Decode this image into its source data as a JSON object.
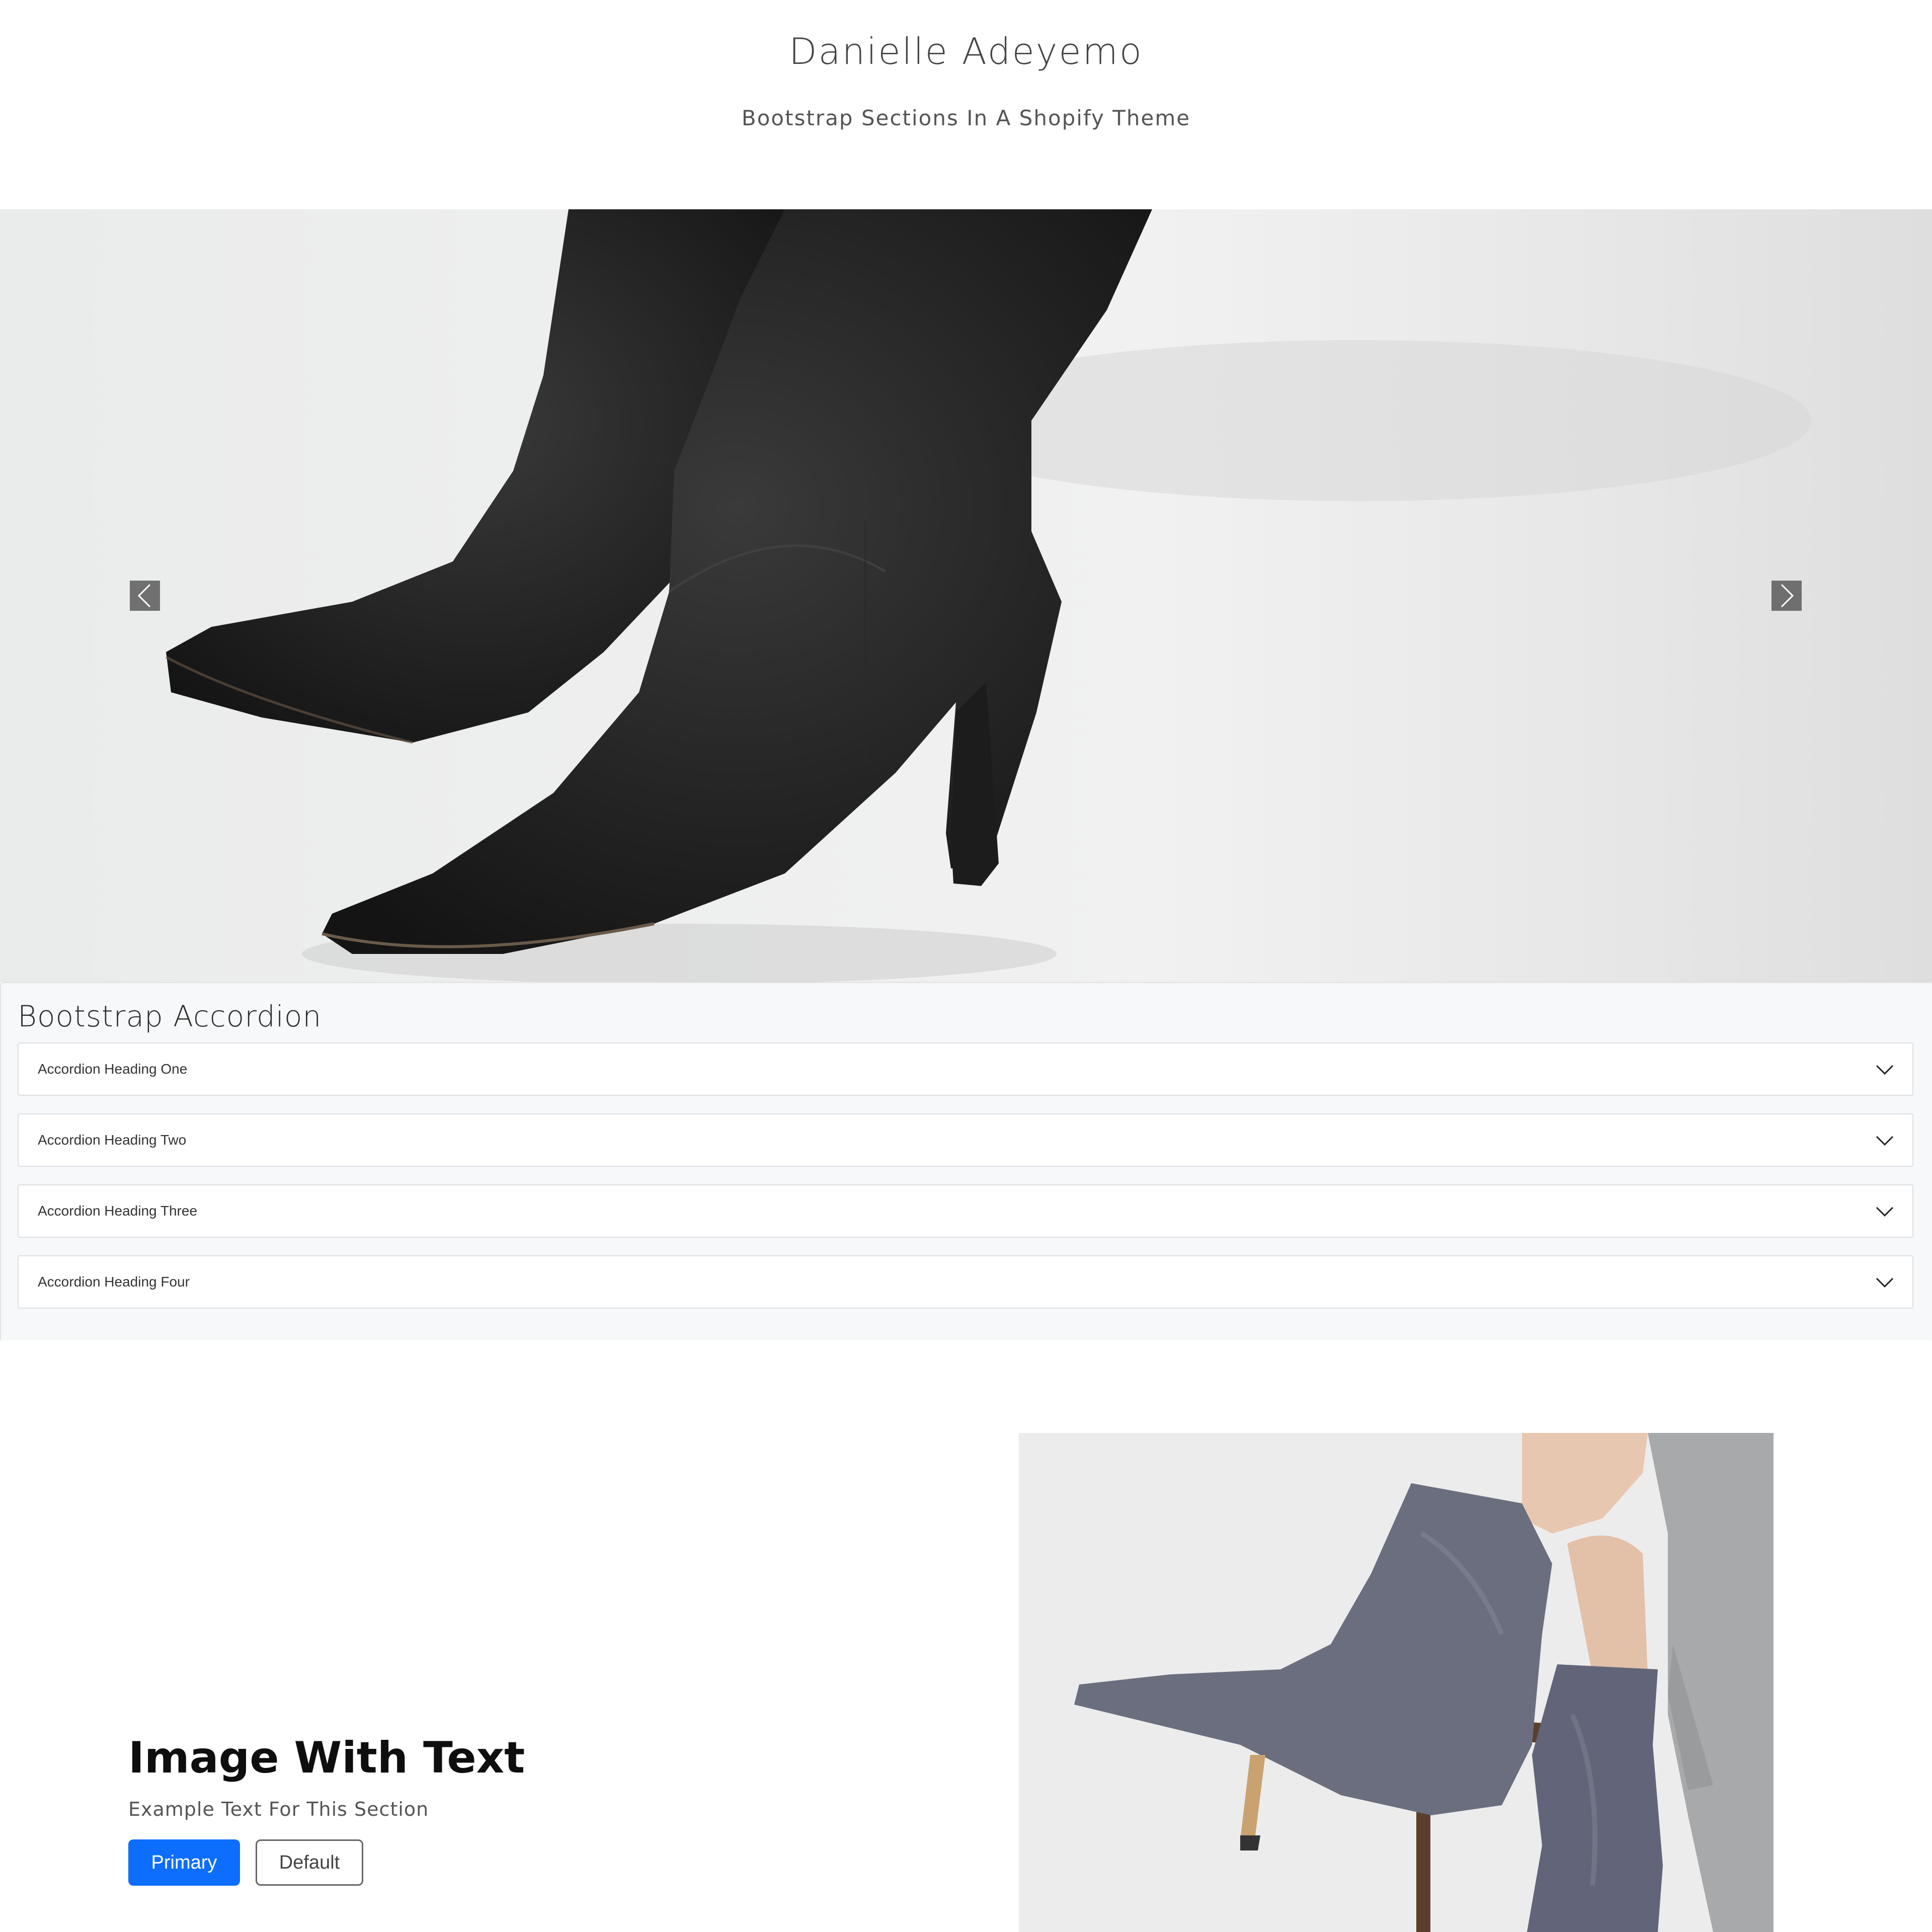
{
  "header": {
    "title": "Danielle Adeyemo",
    "subtitle": "Bootstrap Sections In A Shopify Theme"
  },
  "carousel": {
    "slide_image": "black-suede-boots-photo",
    "prev_icon": "chevron-left-icon",
    "next_icon": "chevron-right-icon"
  },
  "accordion": {
    "title": "Bootstrap Accordion",
    "items": [
      {
        "label": "Accordion Heading One"
      },
      {
        "label": "Accordion Heading Two"
      },
      {
        "label": "Accordion Heading Three"
      },
      {
        "label": "Accordion Heading Four"
      }
    ],
    "toggle_icon": "chevron-down-icon"
  },
  "image_with_text": {
    "heading": "Image With Text",
    "text": "Example Text For This Section",
    "primary_label": "Primary",
    "default_label": "Default",
    "image": "grey-suede-boots-photo"
  },
  "colors": {
    "primary": "#0d6efd",
    "accordion_bg": "#f7f8f9",
    "carousel_bg": "#eceded"
  }
}
